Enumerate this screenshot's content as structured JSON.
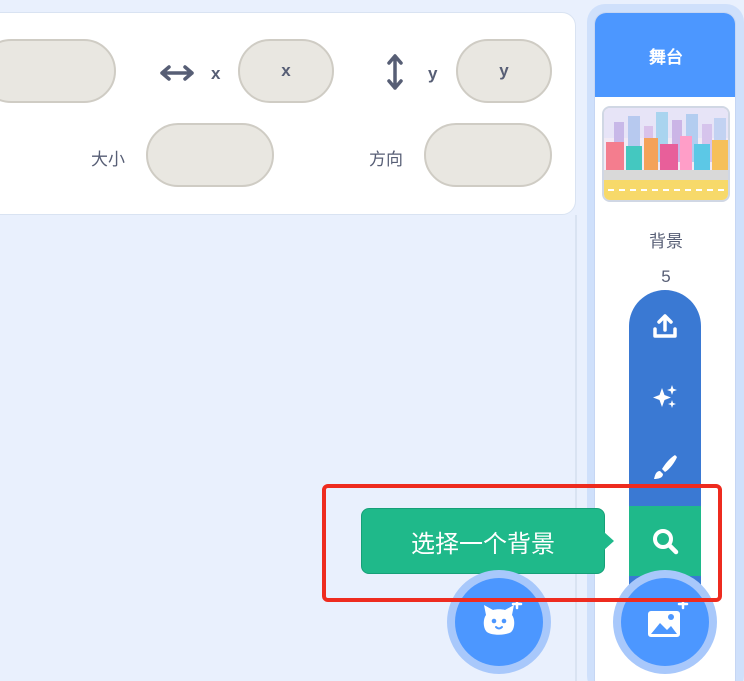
{
  "sprite_info": {
    "x_label": "x",
    "x_value": "x",
    "y_label": "y",
    "y_value": "y",
    "size_label": "大小",
    "direction_label": "方向"
  },
  "stage": {
    "title": "舞台",
    "backdrops_label": "背景",
    "backdrops_count": "5"
  },
  "backdrop_menu": {
    "items": [
      {
        "icon": "upload-icon"
      },
      {
        "icon": "surprise-icon"
      },
      {
        "icon": "paint-icon"
      },
      {
        "icon": "search-icon"
      }
    ]
  },
  "tooltip": {
    "text": "选择一个背景"
  },
  "colors": {
    "accent": "#4c97ff",
    "menu": "#3a79d3",
    "active": "#1fb98a",
    "highlight": "#ee2b1f"
  }
}
